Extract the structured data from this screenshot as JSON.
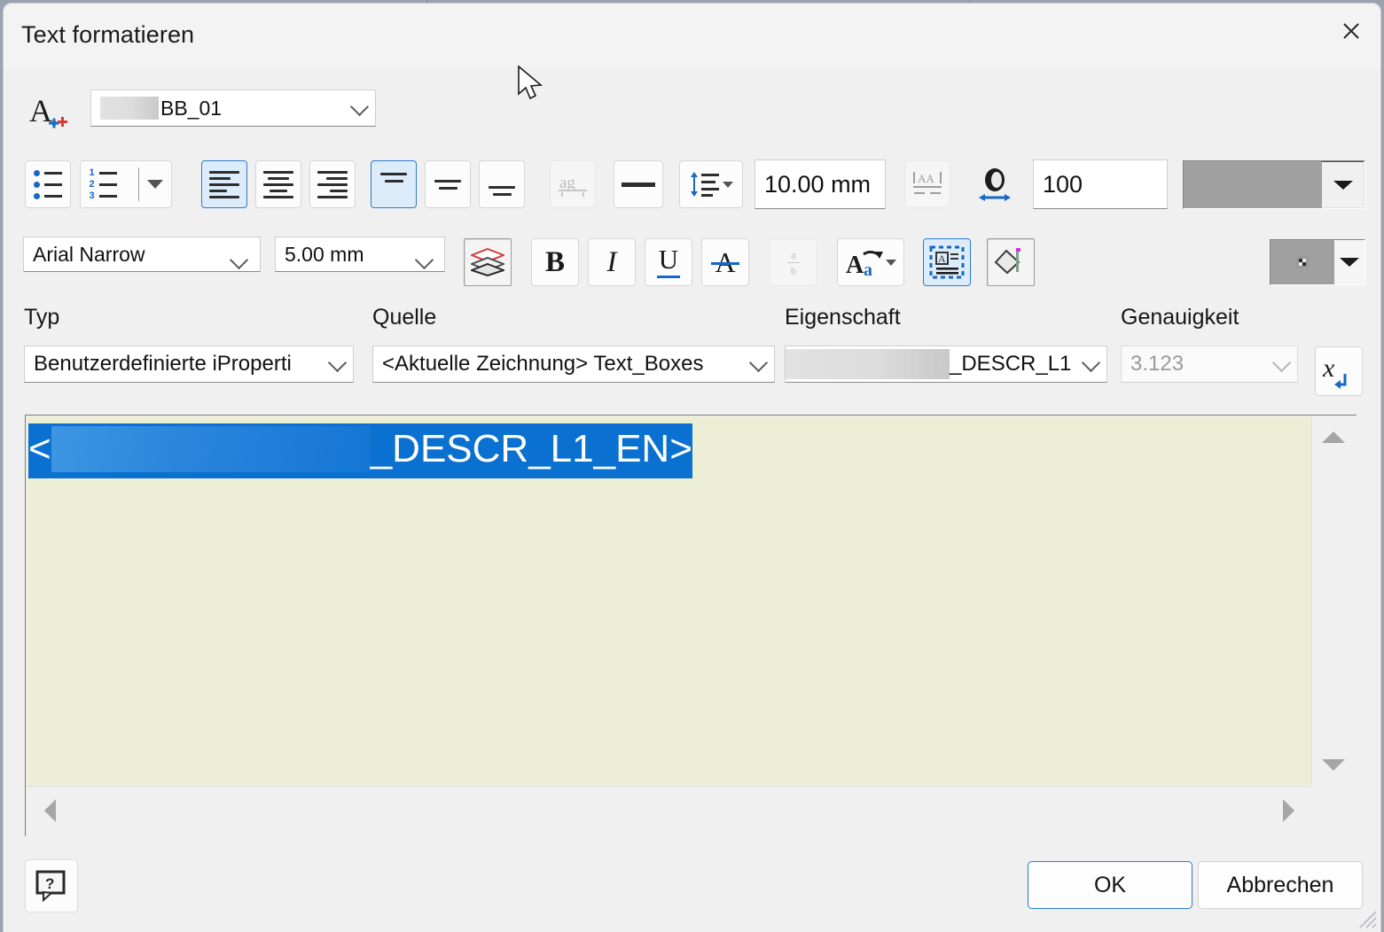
{
  "window": {
    "title": "Text formatieren",
    "close_label": "✕"
  },
  "style_row": {
    "style_icon": "text-style-icon",
    "style_value": "BB_01",
    "style_redacted_prefix": true
  },
  "toolbar_top": {
    "buttons": [
      {
        "name": "bullet-list-button",
        "label": "Aufzählungsliste",
        "state": "normal"
      },
      {
        "name": "numbered-list-button",
        "label": "Nummerierte Liste",
        "state": "normal"
      },
      {
        "name": "align-left-button",
        "label": "Linksbündig",
        "state": "selected"
      },
      {
        "name": "align-center-button",
        "label": "Zentriert",
        "state": "normal"
      },
      {
        "name": "align-right-button",
        "label": "Rechtsbündig",
        "state": "normal"
      },
      {
        "name": "align-top-button",
        "label": "Oben ausrichten",
        "state": "selected"
      },
      {
        "name": "align-middle-button",
        "label": "Mittig ausrichten",
        "state": "normal"
      },
      {
        "name": "align-bottom-button",
        "label": "Unten ausrichten",
        "state": "normal"
      },
      {
        "name": "text-baseline-button",
        "label": "Grundlinie",
        "state": "disabled"
      },
      {
        "name": "horizontal-rule-button",
        "label": "Linie einfügen",
        "state": "normal"
      },
      {
        "name": "line-spacing-button",
        "label": "Zeilenabstand",
        "state": "normal"
      },
      {
        "name": "character-spacing-button",
        "label": "Zeichenabstand",
        "state": "disabled"
      },
      {
        "name": "text-stretch-button",
        "label": "Textbreite",
        "state": "normal"
      }
    ],
    "line_spacing_value": "10.00 mm",
    "stretch_value": "100",
    "color_combo_value": ""
  },
  "toolbar_bottom": {
    "font_value": "Arial Narrow",
    "size_value": "5.00 mm",
    "buttons": [
      {
        "name": "stack-layers-button",
        "label": "Ebenen",
        "state": "pressed"
      },
      {
        "name": "bold-button",
        "label": "B",
        "state": "normal"
      },
      {
        "name": "italic-button",
        "label": "I",
        "state": "normal"
      },
      {
        "name": "underline-button",
        "label": "U",
        "state": "normal"
      },
      {
        "name": "strikethrough-button",
        "label": "A",
        "state": "normal"
      },
      {
        "name": "fraction-button",
        "label": "a/b",
        "state": "disabled"
      },
      {
        "name": "change-case-button",
        "label": "Groß-/Kleinschreibung",
        "state": "normal"
      },
      {
        "name": "text-frame-button",
        "label": "Textrahmen",
        "state": "selected"
      },
      {
        "name": "fill-color-button",
        "label": "Füllfarbe",
        "state": "normal"
      }
    ],
    "pattern_combo_value": ""
  },
  "parameter_row": {
    "typ_label": "Typ",
    "typ_value": "Benutzerdefinierte iProperti",
    "quelle_label": "Quelle",
    "quelle_value": "<Aktuelle Zeichnung>  Text_Boxes",
    "eigenschaft_label": "Eigenschaft",
    "eigenschaft_value": "_DESCR_L1",
    "eigenschaft_redacted_prefix": true,
    "genauigkeit_label": "Genauigkeit",
    "genauigkeit_value": "3.123",
    "insert_parameter_button": "x"
  },
  "editor": {
    "token_prefix": "<",
    "token_suffix": "_DESCR_L1_EN>",
    "token_redacted": true,
    "background_color": "#EDEED6",
    "selection_color": "#0A71D0"
  },
  "footer": {
    "help_label": "?",
    "ok_label": "OK",
    "cancel_label": "Abbrechen"
  },
  "colors": {
    "accent": "#2B7BD0",
    "selection": "#0A71D0",
    "editor_bg": "#EDEED6",
    "dialog_bg": "#F0F0F0",
    "desktop_bg": "#9AA3B0"
  }
}
